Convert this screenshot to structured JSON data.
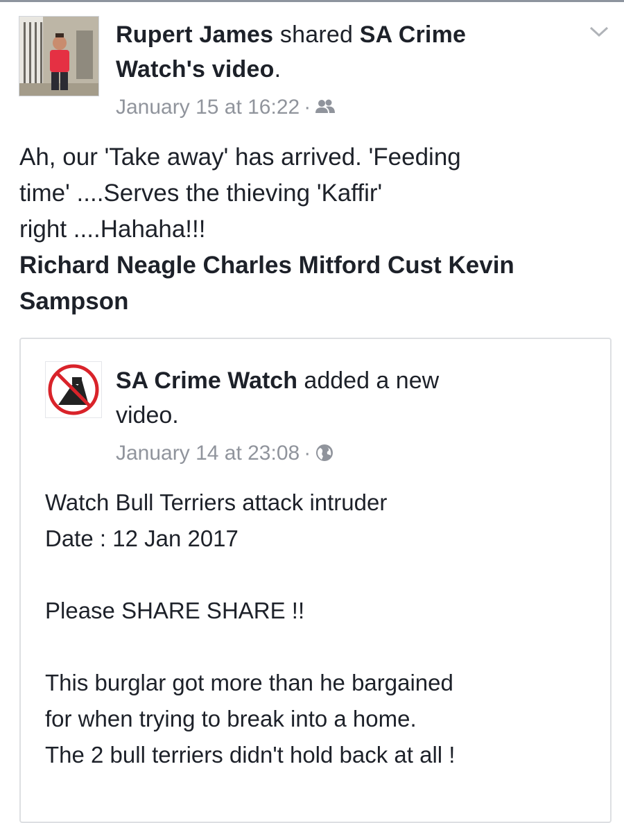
{
  "post": {
    "author": "Rupert James",
    "action_text": " shared ",
    "shared_from": "SA Crime",
    "shared_from_cont": "Watch's video",
    "object_suffix": ".",
    "timestamp": "January 15 at 16:22",
    "separator": "·",
    "audience_icon": "friends-icon",
    "text_lines": [
      "Ah, our 'Take away' has arrived. 'Feeding",
      "time' ....Serves the thieving 'Kaffir'",
      "right ....Hahaha!!!"
    ],
    "tags": [
      "Richard Neagle",
      "Charles Mitford Cust",
      "Kevin",
      "Sampson"
    ]
  },
  "shared_post": {
    "page_name": "SA Crime Watch",
    "action_text": " added a new",
    "action_text_cont": "video.",
    "timestamp": "January 14 at 23:08",
    "separator": "·",
    "audience_icon": "globe-icon",
    "title": "Watch Bull Terriers attack intruder",
    "date_line": "Date : 12 Jan 2017",
    "share_line": "Please SHARE SHARE !!",
    "description_lines": [
      "This burglar got more than he bargained",
      "for when trying to break into a home.",
      "The 2 bull terriers didn't hold back at all !"
    ]
  },
  "colors": {
    "text": "#1d2129",
    "meta": "#90949c",
    "border": "#dddfe2",
    "prohibition_red": "#d9232a"
  }
}
